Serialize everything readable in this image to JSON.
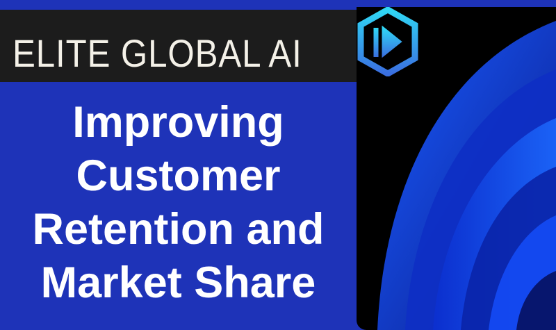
{
  "brand": {
    "name": "ELITE GLOBAL AI"
  },
  "headline": {
    "lines": [
      "Improving",
      "Customer",
      "Retention and",
      "Market Share"
    ]
  },
  "colors": {
    "background": "#1e33b8",
    "band": "#1c1c1c",
    "logo": "#2ec8f0"
  }
}
